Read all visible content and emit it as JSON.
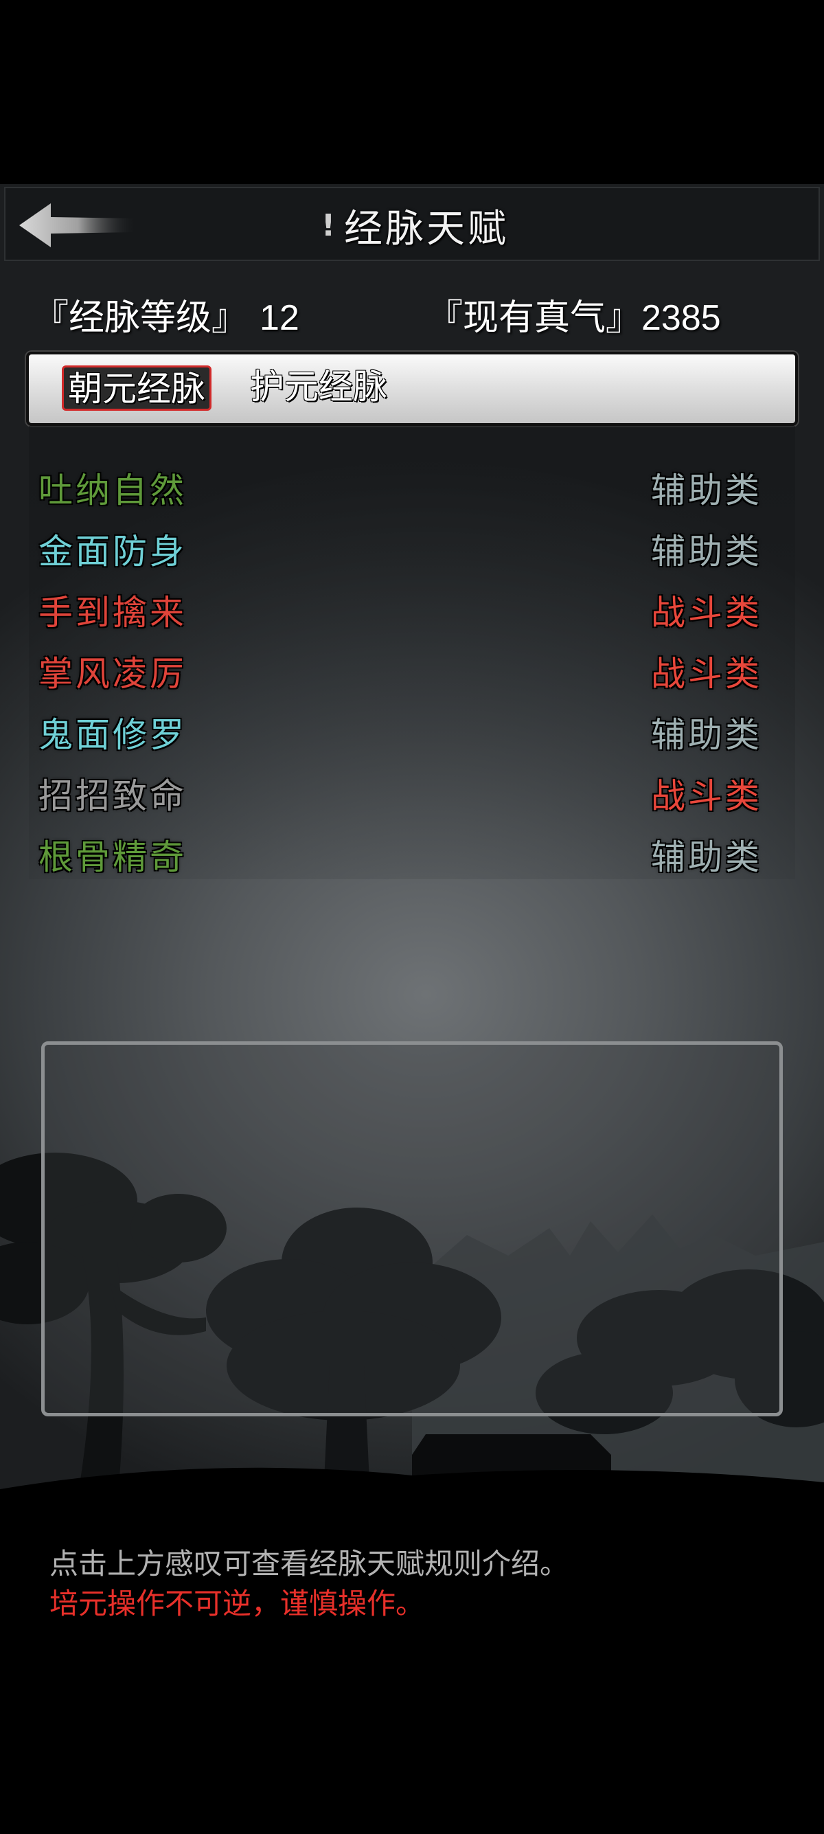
{
  "header": {
    "title": "经脉天赋",
    "info_icon": "!"
  },
  "stats": {
    "level_label": "『经脉等级』",
    "level_value": "12",
    "qi_label": "『现有真气』",
    "qi_value": "2385"
  },
  "tabs": [
    {
      "label": "朝元经脉",
      "active": true
    },
    {
      "label": "护元经脉",
      "active": false
    }
  ],
  "talents": [
    {
      "name": "吐纳自然",
      "type": "辅助类",
      "name_color": "#5f9a3a",
      "type_color": "#9fb0b2"
    },
    {
      "name": "金面防身",
      "type": "辅助类",
      "name_color": "#6fd0d6",
      "type_color": "#9fb0b2"
    },
    {
      "name": "手到擒来",
      "type": "战斗类",
      "name_color": "#e0443a",
      "type_color": "#e8473b"
    },
    {
      "name": "掌风凌厉",
      "type": "战斗类",
      "name_color": "#e0443a",
      "type_color": "#e8473b"
    },
    {
      "name": "鬼面修罗",
      "type": "辅助类",
      "name_color": "#6fd0d6",
      "type_color": "#9fb0b2"
    },
    {
      "name": "招招致命",
      "type": "战斗类",
      "name_color": "#9a9a9a",
      "type_color": "#e8473b"
    },
    {
      "name": "根骨精奇",
      "type": "辅助类",
      "name_color": "#5f9a3a",
      "type_color": "#9fb0b2"
    }
  ],
  "notes": {
    "hint": "点击上方感叹可查看经脉天赋规则介绍。",
    "warning": "培元操作不可逆，谨慎操作。"
  },
  "icons": {
    "back": "back-arrow-icon",
    "info": "exclamation-icon"
  },
  "colors": {
    "active_tab_border": "#d22a2a",
    "warning_text": "#e8302a"
  }
}
